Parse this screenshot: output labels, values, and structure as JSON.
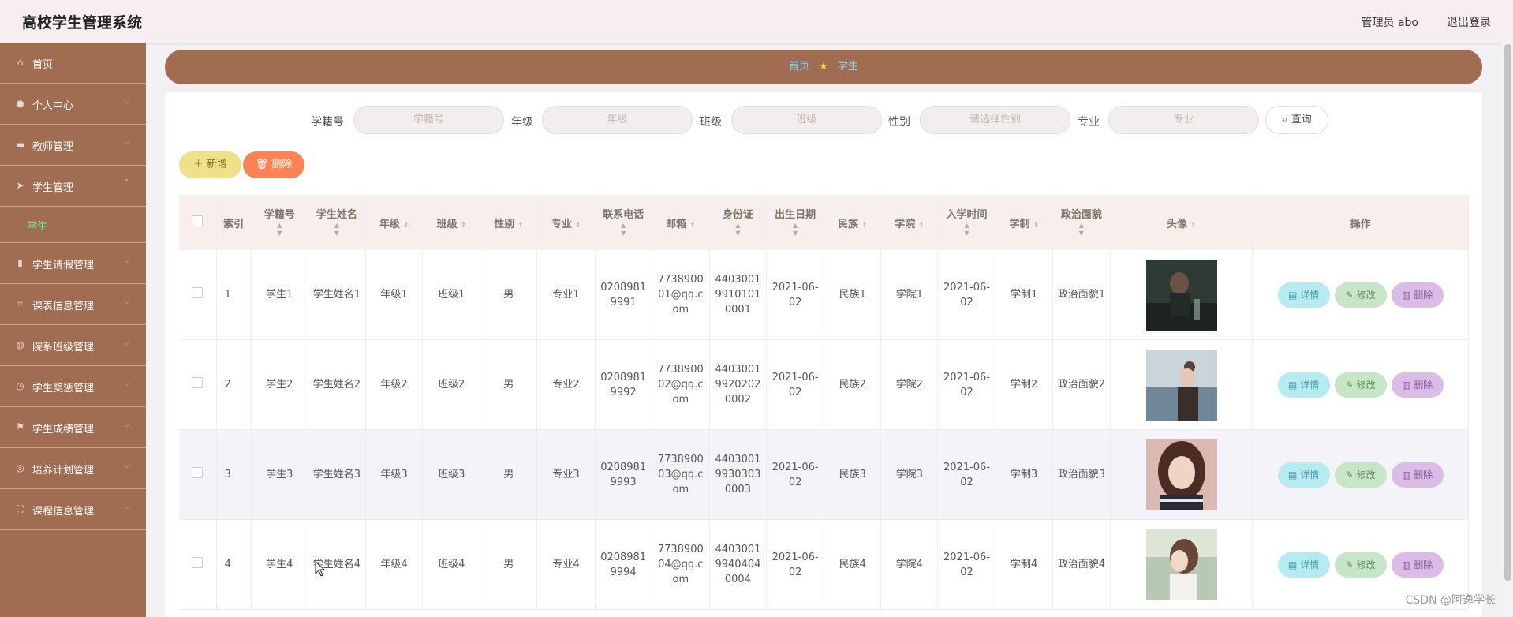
{
  "header": {
    "title": "高校学生管理系统",
    "admin": "管理员 abo",
    "logout": "退出登录"
  },
  "sidebar": {
    "items": [
      {
        "label": "首页",
        "icon": "home-icon",
        "arrow": ""
      },
      {
        "label": "个人中心",
        "icon": "user-icon",
        "arrow": "⌵"
      },
      {
        "label": "教师管理",
        "icon": "briefcase-icon",
        "arrow": "⌵"
      },
      {
        "label": "学生管理",
        "icon": "send-icon",
        "arrow": "⌃"
      },
      {
        "label": "学生请假管理",
        "icon": "chart-icon",
        "arrow": "⌵"
      },
      {
        "label": "课表信息管理",
        "icon": "crop-icon",
        "arrow": "⌵"
      },
      {
        "label": "院系班级管理",
        "icon": "globe-icon",
        "arrow": "⌵"
      },
      {
        "label": "学生奖惩管理",
        "icon": "clock-icon",
        "arrow": "⌵"
      },
      {
        "label": "学生成绩管理",
        "icon": "flag-icon",
        "arrow": "⌵"
      },
      {
        "label": "培养计划管理",
        "icon": "world-icon",
        "arrow": "⌵"
      },
      {
        "label": "课程信息管理",
        "icon": "fullscreen-icon",
        "arrow": "⌵"
      }
    ],
    "sub_item": "学生"
  },
  "breadcrumb": {
    "home": "首页",
    "current": "学生"
  },
  "search": {
    "fields": [
      {
        "label": "学籍号",
        "placeholder": "学籍号"
      },
      {
        "label": "年级",
        "placeholder": "年级"
      },
      {
        "label": "班级",
        "placeholder": "班级"
      },
      {
        "label": "性别",
        "placeholder": "请选择性别"
      },
      {
        "label": "专业",
        "placeholder": "专业"
      }
    ],
    "button": "查询"
  },
  "actions": {
    "add": "新增",
    "delete": "删除"
  },
  "table": {
    "headers": [
      "索引",
      "学籍号",
      "学生姓名",
      "年级",
      "班级",
      "性别",
      "专业",
      "联系电话",
      "邮箱",
      "身份证",
      "出生日期",
      "民族",
      "学院",
      "入学时间",
      "学制",
      "政治面貌",
      "头像",
      "操作"
    ],
    "rows": [
      {
        "index": "1",
        "xuejihao": "学生1",
        "name": "学生姓名1",
        "grade": "年级1",
        "cls": "班级1",
        "gender": "男",
        "major": "专业1",
        "phone": "02089819991",
        "email": "773890001@qq.com",
        "idcard": "440300199101010001",
        "birth": "2021-06-02",
        "ethnic": "民族1",
        "college": "学院1",
        "enroll": "2021-06-02",
        "system": "学制1",
        "political": "政治面貌1"
      },
      {
        "index": "2",
        "xuejihao": "学生2",
        "name": "学生姓名2",
        "grade": "年级2",
        "cls": "班级2",
        "gender": "男",
        "major": "专业2",
        "phone": "02089819992",
        "email": "773890002@qq.com",
        "idcard": "440300199202020002",
        "birth": "2021-06-02",
        "ethnic": "民族2",
        "college": "学院2",
        "enroll": "2021-06-02",
        "system": "学制2",
        "political": "政治面貌2"
      },
      {
        "index": "3",
        "xuejihao": "学生3",
        "name": "学生姓名3",
        "grade": "年级3",
        "cls": "班级3",
        "gender": "男",
        "major": "专业3",
        "phone": "02089819993",
        "email": "773890003@qq.com",
        "idcard": "440300199303030003",
        "birth": "2021-06-02",
        "ethnic": "民族3",
        "college": "学院3",
        "enroll": "2021-06-02",
        "system": "学制3",
        "political": "政治面貌3"
      },
      {
        "index": "4",
        "xuejihao": "学生4",
        "name": "学生姓名4",
        "grade": "年级4",
        "cls": "班级4",
        "gender": "男",
        "major": "专业4",
        "phone": "02089819994",
        "email": "773890004@qq.com",
        "idcard": "440300199404040004",
        "birth": "2021-06-02",
        "ethnic": "民族4",
        "college": "学院4",
        "enroll": "2021-06-02",
        "system": "学制4",
        "political": "政治面貌4"
      }
    ],
    "row_ops": {
      "detail": "详情",
      "edit": "修改",
      "remove": "删除"
    }
  },
  "watermark": "CSDN @阿逸学长",
  "colors": {
    "sidebar": "#a06d52",
    "breadcrumb": "#a06d52",
    "submenu_active": "#7cf08a"
  }
}
